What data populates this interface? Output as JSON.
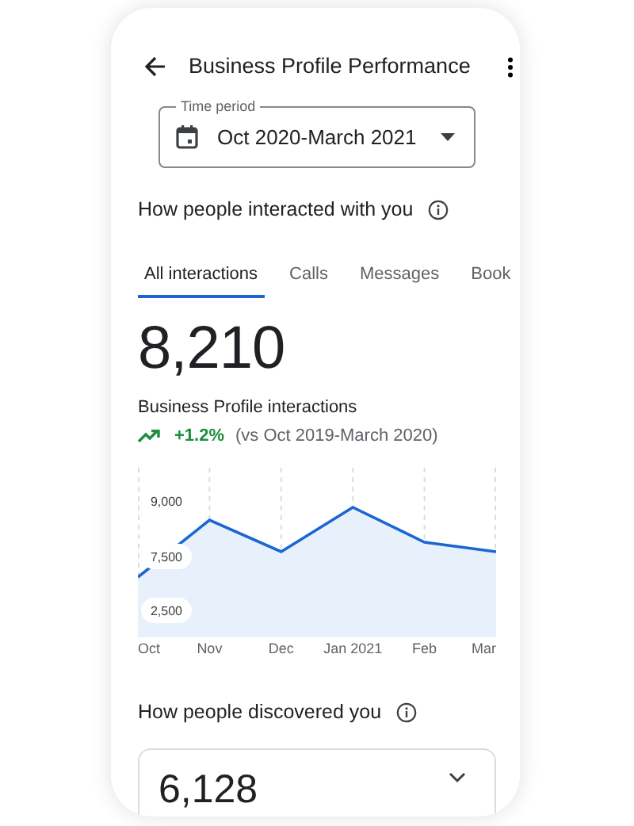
{
  "header": {
    "title": "Business Profile Performance"
  },
  "time_period": {
    "label": "Time period",
    "value": "Oct 2020-March 2021"
  },
  "interactions": {
    "heading": "How people interacted with you",
    "tabs": [
      {
        "label": "All interactions",
        "selected": true
      },
      {
        "label": "Calls",
        "selected": false
      },
      {
        "label": "Messages",
        "selected": false
      },
      {
        "label": "Book",
        "selected": false
      }
    ],
    "total": "8,210",
    "caption": "Business Profile interactions",
    "change": "+1.2%",
    "comparison": "(vs Oct 2019-March 2020)",
    "chart": {
      "y_labels": [
        "9,000",
        "7,500",
        "2,500"
      ],
      "x_labels": [
        "Oct",
        "Nov",
        "Dec",
        "Jan 2021",
        "Feb",
        "Mar"
      ]
    }
  },
  "discovery": {
    "heading": "How people discovered you",
    "total": "6,128"
  }
}
